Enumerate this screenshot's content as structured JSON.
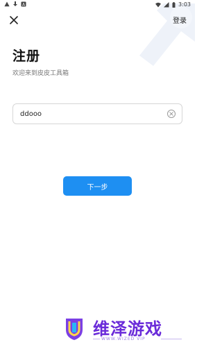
{
  "status_bar": {
    "time": "3:03",
    "icons": [
      "warning-icon",
      "download-icon",
      "a-icon",
      "wifi-icon",
      "signal-icon",
      "battery-icon"
    ]
  },
  "header": {
    "close_icon": "close-icon",
    "login_label": "登录"
  },
  "page": {
    "title": "注册",
    "subtitle": "欢迎来到皮皮工具箱"
  },
  "form": {
    "input_value": "ddooo",
    "clear_icon": "clear-icon"
  },
  "actions": {
    "next_label": "下一步",
    "accent_color": "#1e8ff2"
  },
  "watermark": {
    "text": "维泽游戏",
    "sub": "WWW.WIZED VIP"
  }
}
